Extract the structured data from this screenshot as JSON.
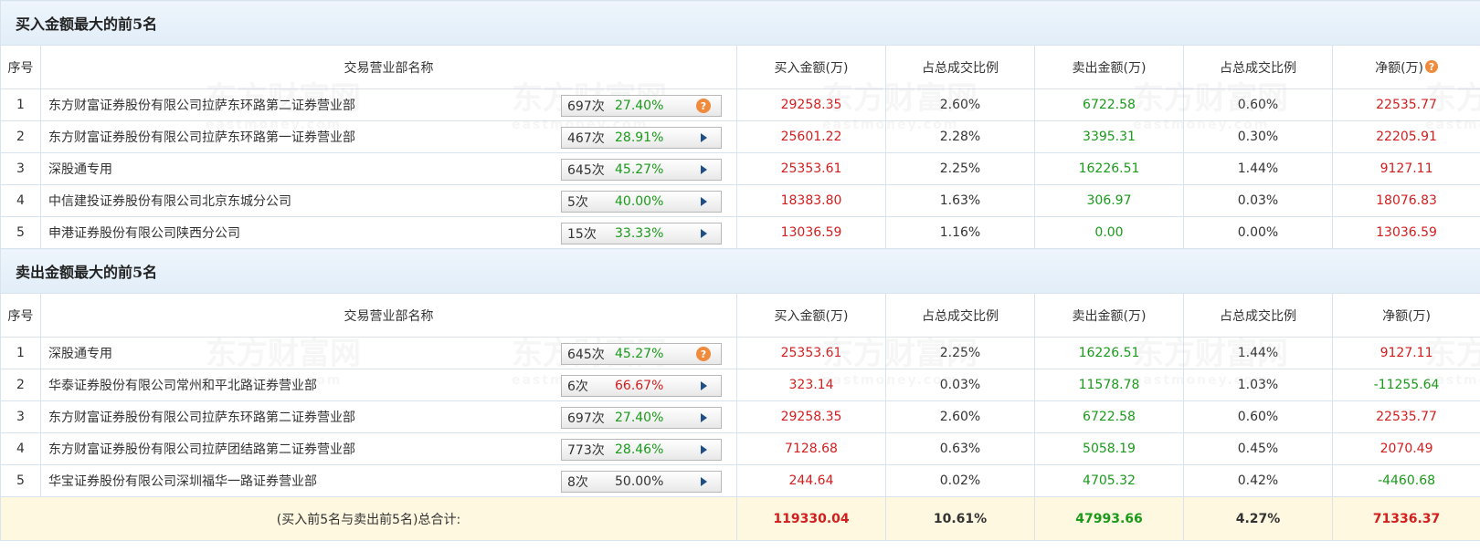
{
  "watermark": {
    "logo": "东方财富网",
    "url": "eastmoney.com"
  },
  "buy": {
    "title": "买入金额最大的前5名",
    "headers": [
      "序号",
      "交易营业部名称",
      "买入金额(万)",
      "占总成交比例",
      "卖出金额(万)",
      "占总成交比例",
      "净额(万)"
    ],
    "rows": [
      {
        "idx": "1",
        "name": "东方财富证券股份有限公司拉萨东环路第二证券营业部",
        "count": "697次",
        "rate": "27.40%",
        "rate_color": "green",
        "icon": "question-icon",
        "buy": "29258.35",
        "buy_pct": "2.60%",
        "sell": "6722.58",
        "sell_pct": "0.60%",
        "net": "22535.77",
        "net_color": "red"
      },
      {
        "idx": "2",
        "name": "东方财富证券股份有限公司拉萨东环路第一证券营业部",
        "count": "467次",
        "rate": "28.91%",
        "rate_color": "green",
        "icon": "arrow-right-icon",
        "buy": "25601.22",
        "buy_pct": "2.28%",
        "sell": "3395.31",
        "sell_pct": "0.30%",
        "net": "22205.91",
        "net_color": "red"
      },
      {
        "idx": "3",
        "name": "深股通专用",
        "count": "645次",
        "rate": "45.27%",
        "rate_color": "green",
        "icon": "arrow-right-icon",
        "buy": "25353.61",
        "buy_pct": "2.25%",
        "sell": "16226.51",
        "sell_pct": "1.44%",
        "net": "9127.11",
        "net_color": "red"
      },
      {
        "idx": "4",
        "name": "中信建投证券股份有限公司北京东城分公司",
        "count": "5次",
        "rate": "40.00%",
        "rate_color": "green",
        "icon": "arrow-right-icon",
        "buy": "18383.80",
        "buy_pct": "1.63%",
        "sell": "306.97",
        "sell_pct": "0.03%",
        "net": "18076.83",
        "net_color": "red"
      },
      {
        "idx": "5",
        "name": "申港证券股份有限公司陕西分公司",
        "count": "15次",
        "rate": "33.33%",
        "rate_color": "green",
        "icon": "arrow-right-icon",
        "buy": "13036.59",
        "buy_pct": "1.16%",
        "sell": "0.00",
        "sell_pct": "0.00%",
        "net": "13036.59",
        "net_color": "red"
      }
    ]
  },
  "sell": {
    "title": "卖出金额最大的前5名",
    "headers": [
      "序号",
      "交易营业部名称",
      "买入金额(万)",
      "占总成交比例",
      "卖出金额(万)",
      "占总成交比例",
      "净额(万)"
    ],
    "rows": [
      {
        "idx": "1",
        "name": "深股通专用",
        "count": "645次",
        "rate": "45.27%",
        "rate_color": "green",
        "icon": "question-icon",
        "buy": "25353.61",
        "buy_pct": "2.25%",
        "sell": "16226.51",
        "sell_pct": "1.44%",
        "net": "9127.11",
        "net_color": "red"
      },
      {
        "idx": "2",
        "name": "华泰证券股份有限公司常州和平北路证券营业部",
        "count": "6次",
        "rate": "66.67%",
        "rate_color": "red",
        "icon": "arrow-right-icon",
        "buy": "323.14",
        "buy_pct": "0.03%",
        "sell": "11578.78",
        "sell_pct": "1.03%",
        "net": "-11255.64",
        "net_color": "green"
      },
      {
        "idx": "3",
        "name": "东方财富证券股份有限公司拉萨东环路第二证券营业部",
        "count": "697次",
        "rate": "27.40%",
        "rate_color": "green",
        "icon": "arrow-right-icon",
        "buy": "29258.35",
        "buy_pct": "2.60%",
        "sell": "6722.58",
        "sell_pct": "0.60%",
        "net": "22535.77",
        "net_color": "red"
      },
      {
        "idx": "4",
        "name": "东方财富证券股份有限公司拉萨团结路第二证券营业部",
        "count": "773次",
        "rate": "28.46%",
        "rate_color": "green",
        "icon": "arrow-right-icon",
        "buy": "7128.68",
        "buy_pct": "0.63%",
        "sell": "5058.19",
        "sell_pct": "0.45%",
        "net": "2070.49",
        "net_color": "red"
      },
      {
        "idx": "5",
        "name": "华宝证券股份有限公司深圳福华一路证券营业部",
        "count": "8次",
        "rate": "50.00%",
        "rate_color": "dark",
        "icon": "arrow-right-icon",
        "buy": "244.64",
        "buy_pct": "0.02%",
        "sell": "4705.32",
        "sell_pct": "0.42%",
        "net": "-4460.68",
        "net_color": "green"
      }
    ]
  },
  "total": {
    "label": "(买入前5名与卖出前5名)总合计:",
    "buy": "119330.04",
    "buy_pct": "10.61%",
    "sell": "47993.66",
    "sell_pct": "4.27%",
    "net": "71336.37"
  },
  "colors": {
    "red": "#d21e1e",
    "green": "#1a9a1a",
    "header_bg": "#e1edf8",
    "total_bg": "#fff8e0"
  }
}
